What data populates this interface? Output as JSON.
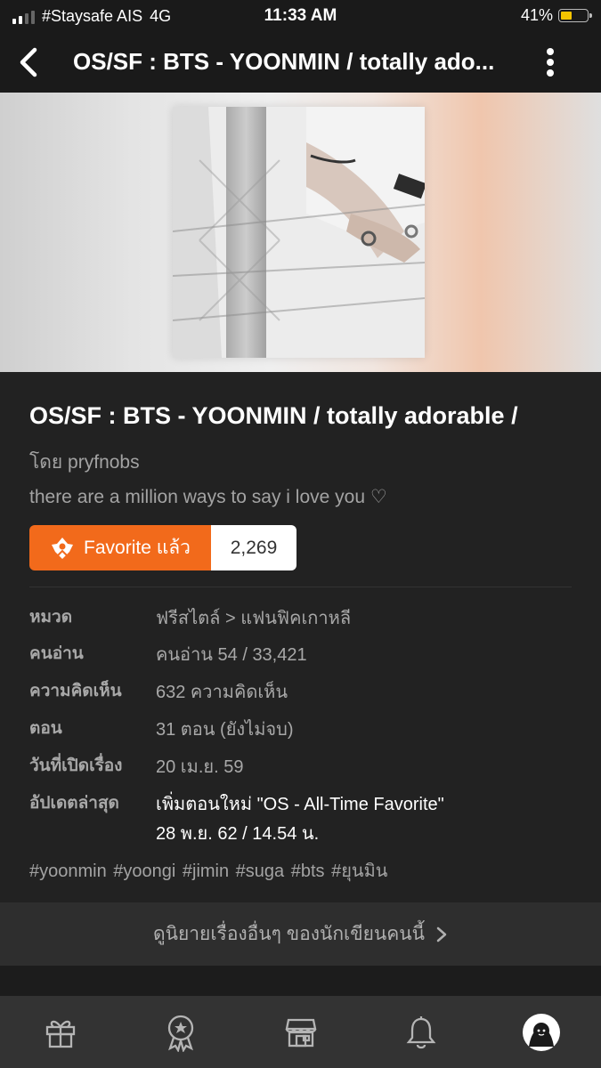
{
  "status_bar": {
    "carrier": "#Staysafe AIS",
    "network": "4G",
    "time": "11:33 AM",
    "battery": "41%",
    "battery_color": "#f5c400"
  },
  "nav": {
    "title": "OS/SF : BTS - YOONMIN / totally ado...",
    "back_icon": "chevron-left-icon",
    "more_icon": "vertical-dots-icon"
  },
  "story": {
    "title": "OS/SF : BTS - YOONMIN / totally adorable /",
    "author_line": "โดย pryfnobs",
    "tagline": "there are a million ways to say i love you ♡",
    "favorite_label": "Favorite แล้ว",
    "favorite_count": "2,269",
    "accent_color": "#f26a1b"
  },
  "meta": {
    "category_label": "หมวด",
    "category_value": "ฟรีสไตล์ > แฟนฟิคเกาหลี",
    "readers_label": "คนอ่าน",
    "readers_value": "คนอ่าน 54 / 33,421",
    "comments_label": "ความคิดเห็น",
    "comments_value": "632 ความคิดเห็น",
    "episodes_label": "ตอน",
    "episodes_value": "31 ตอน (ยังไม่จบ)",
    "opened_label": "วันที่เปิดเรื่อง",
    "opened_value": "20 เม.ย. 59",
    "updated_label": "อัปเดตล่าสุด",
    "updated_value": "เพิ่มตอนใหม่ \"OS - All-Time Favorite\"",
    "updated_date": "28 พ.ย. 62 / 14.54 น."
  },
  "tags": "#yoonmin #yoongi #jimin #suga #bts #ยุนมิน",
  "more_stories_label": "ดูนิยายเรื่องอื่นๆ ของนักเขียนคนนี้",
  "tab_bar": {
    "tabs": [
      "gift-icon",
      "award-icon",
      "store-icon",
      "bell-icon",
      "profile-avatar-icon"
    ]
  }
}
